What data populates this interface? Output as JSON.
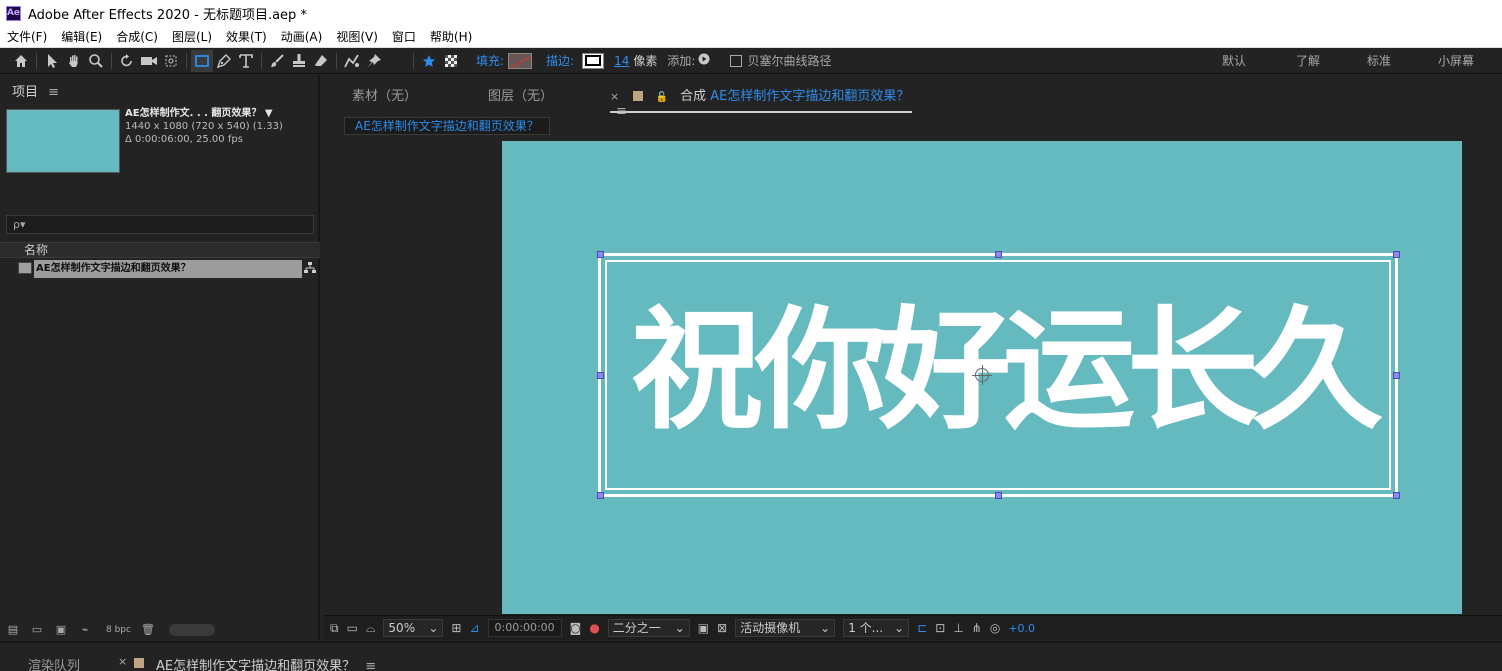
{
  "window": {
    "logo": "Ae",
    "title": "Adobe After Effects 2020 - 无标题项目.aep *"
  },
  "menu": [
    "文件(F)",
    "编辑(E)",
    "合成(C)",
    "图层(L)",
    "效果(T)",
    "动画(A)",
    "视图(V)",
    "窗口",
    "帮助(H)"
  ],
  "toolbar": {
    "fill_label": "填充:",
    "stroke_label": "描边:",
    "stroke_width": "14",
    "stroke_unit": "像素",
    "add_label": "添加:",
    "bezier_label": "贝塞尔曲线路径",
    "workspaces": [
      "默认",
      "了解",
      "标准",
      "小屏幕"
    ]
  },
  "project": {
    "tab_label": "项目",
    "comp_name": "AE怎样制作文. . . 翻页效果？ ▼",
    "comp_size": "1440 x 1080  (720 x 540) (1.33)",
    "comp_duration": "Δ 0:00:06:00, 25.00 fps",
    "search_placeholder": "ρ▾",
    "column_name": "名称",
    "items": [
      {
        "label": "AE怎样制作文字描边和翻页效果？"
      }
    ],
    "bpc": "8 bpc"
  },
  "composition": {
    "tabs": [
      "素材（无）",
      "图层（无）"
    ],
    "active_tab_prefix": "合成",
    "active_tab_name": "AE怎样制作文字描边和翻页效果？",
    "breadcrumb": "AE怎样制作文字描边和翻页效果？",
    "canvas_text": "祝你好运长久",
    "canvas_color": "#64babf",
    "footer": {
      "zoom": "50%",
      "timecode": "0:00:00:00",
      "resolution": "二分之一",
      "camera": "活动摄像机",
      "views": "1 个...",
      "exposure": "+0.0"
    }
  },
  "bottom": {
    "render_queue": "渲染队列",
    "timeline_tab": "AE怎样制作文字描边和翻页效果？"
  },
  "colors": {
    "accent": "#2d8ceb",
    "panel_bg": "#232323",
    "handle": "#8a8af0"
  }
}
